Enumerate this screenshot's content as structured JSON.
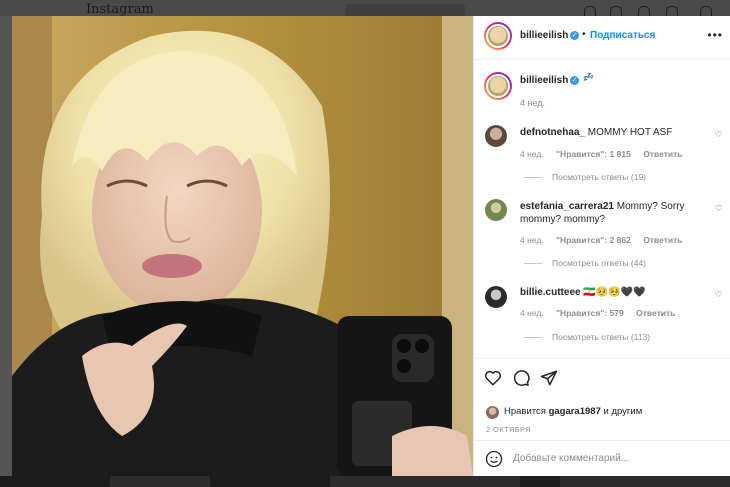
{
  "background": {
    "logo": "Instagram"
  },
  "post": {
    "author": "billieeilish",
    "follow_label": "Подписаться",
    "caption_emoji": "💤",
    "caption_time": "4 нед.",
    "likes_prefix": "Нравится",
    "likes_user": "gagara1987",
    "likes_suffix": "и другим",
    "date": "2 ОКТЯБРЯ",
    "add_comment_placeholder": "Добавьте комментарий..."
  },
  "comments": [
    {
      "user": "defnotnehaa_",
      "text": "MOMMY HOT ASF",
      "time": "4 нед.",
      "likes": "\"Нравится\": 1 815",
      "reply": "Ответить",
      "view_replies": "Посмотреть ответы (19)"
    },
    {
      "user": "estefania_carrera21",
      "text": "Mommy? Sorry mommy? mommy?",
      "time": "4 нед.",
      "likes": "\"Нравится\": 2 862",
      "reply": "Ответить",
      "view_replies": "Посмотреть ответы (44)"
    },
    {
      "user": "billie.cutteee",
      "text": "🇮🇷🥺🥺🖤🖤",
      "time": "4 нед.",
      "likes": "\"Нравится\": 579",
      "reply": "Ответить",
      "view_replies": "Посмотреть ответы (113)"
    }
  ],
  "icons": {
    "more": "more-horizontal-icon",
    "verified": "verified-badge-icon",
    "like": "heart-icon",
    "comment": "comment-icon",
    "share": "share-icon",
    "emoji": "smile-icon"
  },
  "colors": {
    "accent": "#0095f6",
    "verified": "#3897f0",
    "text": "#262626",
    "muted": "#8e8e8e"
  }
}
